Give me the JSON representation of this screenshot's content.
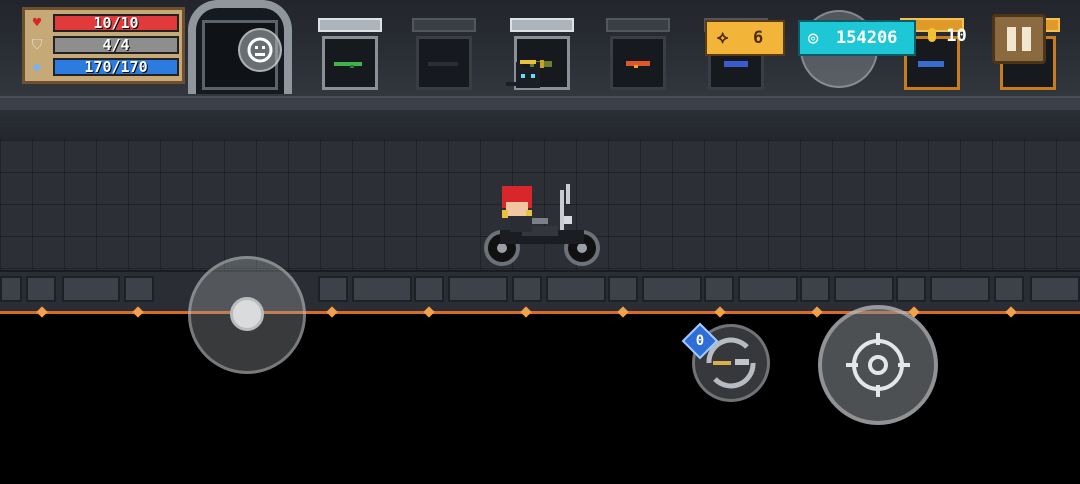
{
  "hud": {
    "health": {
      "label": "10/10",
      "fraction": 1.0,
      "color": "#e23a3a"
    },
    "armor": {
      "label": "4/4",
      "fraction": 1.0,
      "color": "#8e8e8e"
    },
    "energy": {
      "label": "170/170",
      "fraction": 1.0,
      "color": "#2c7be0"
    }
  },
  "currency": {
    "fish": "6",
    "gems": "154206",
    "coins": "10"
  },
  "switch_weapon": {
    "badge": "0"
  },
  "colors": {
    "panel": "#c7a877",
    "gold": "#f3b43a",
    "gem": "#1ec7d6",
    "lava": "#d8692a"
  },
  "icons": [
    "heart-icon",
    "shield-icon",
    "energy-icon",
    "fish-icon",
    "gem-icon",
    "coin-icon",
    "pause-icon",
    "emote-icon",
    "crosshair-icon",
    "weapon-swap-icon"
  ]
}
